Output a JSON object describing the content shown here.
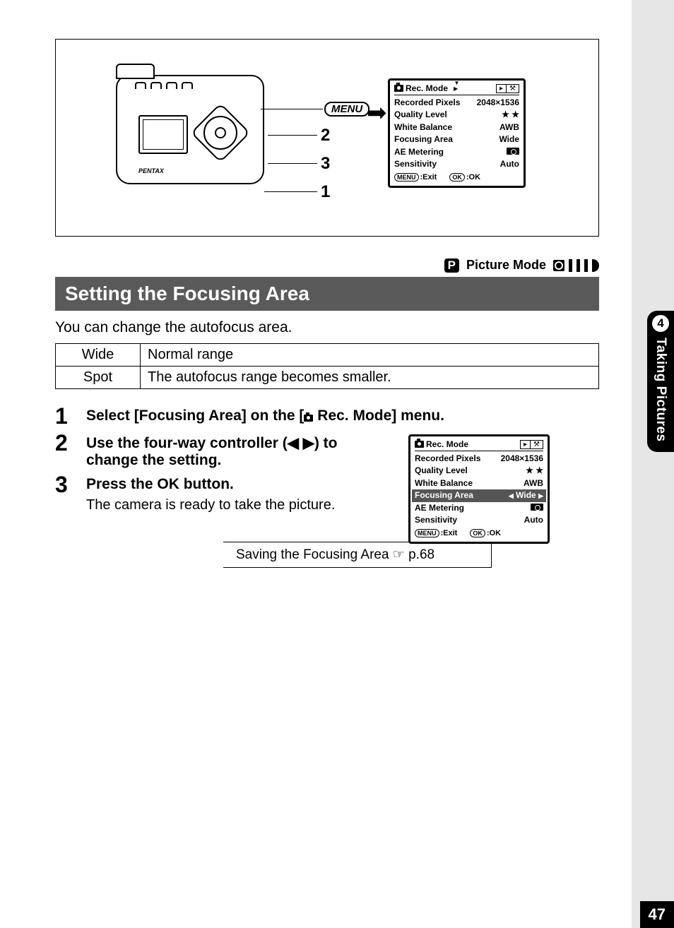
{
  "sidebar": {
    "chapter_num": "4",
    "chapter_title": "Taking Pictures",
    "page_num": "47"
  },
  "diagram": {
    "menu_label": "MENU",
    "brand": "PENTAX",
    "callouts": [
      "1",
      "2",
      "3"
    ]
  },
  "lcd_top": {
    "title": "Rec. Mode",
    "rows": [
      {
        "label": "Recorded Pixels",
        "value": "2048×1536"
      },
      {
        "label": "Quality Level",
        "value": "★ ★"
      },
      {
        "label": "White Balance",
        "value": "AWB"
      },
      {
        "label": "Focusing Area",
        "value": "Wide"
      },
      {
        "label": "AE Metering",
        "value": "__spot__"
      },
      {
        "label": "Sensitivity",
        "value": "Auto"
      }
    ],
    "footer": {
      "exit_btn": "MENU",
      "exit": "Exit",
      "ok_btn": "OK",
      "ok": "OK"
    }
  },
  "mode_bar": {
    "p": "P",
    "label": "Picture Mode"
  },
  "heading": "Setting the Focusing Area",
  "intro": "You can change the autofocus area.",
  "range_table": [
    {
      "name": "Wide",
      "desc": "Normal range"
    },
    {
      "name": "Spot",
      "desc": "The autofocus range becomes smaller."
    }
  ],
  "steps": {
    "s1_num": "1",
    "s1_a": "Select [Focusing Area] on the [",
    "s1_b": " Rec. Mode] menu.",
    "s2_num": "2",
    "s2": "Use the four-way controller (◀ ▶) to change the setting.",
    "s3_num": "3",
    "s3": "Press the OK button.",
    "s3_note": "The camera is ready to take the picture."
  },
  "lcd_bottom": {
    "title": "Rec. Mode",
    "rows": [
      {
        "label": "Recorded Pixels",
        "value": "2048×1536"
      },
      {
        "label": "Quality Level",
        "value": "★ ★"
      },
      {
        "label": "White Balance",
        "value": "AWB"
      },
      {
        "label": "Focusing Area",
        "value": "Wide",
        "hl": true
      },
      {
        "label": "AE Metering",
        "value": "__spot__"
      },
      {
        "label": "Sensitivity",
        "value": "Auto"
      }
    ],
    "footer": {
      "exit_btn": "MENU",
      "exit": "Exit",
      "ok_btn": "OK",
      "ok": "OK"
    }
  },
  "crossref": "Saving the Focusing Area ☞ p.68"
}
